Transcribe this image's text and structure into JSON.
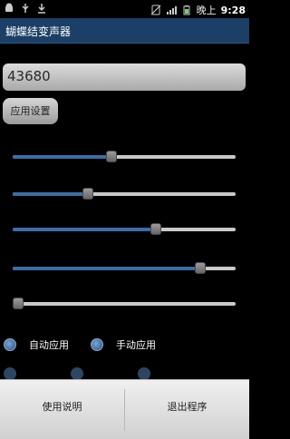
{
  "status_bar": {
    "period": "晚上",
    "time": "9:28"
  },
  "title": "蝴蝶结变声器",
  "number_field": {
    "value": "43680"
  },
  "settings_button": {
    "label": "应用设置"
  },
  "sliders": [
    {
      "level": 0.44
    },
    {
      "level": 0.33
    },
    {
      "level": 0.65
    },
    {
      "level": 0.86
    },
    {
      "level": 0.0
    }
  ],
  "radio_auto": {
    "label": "自动应用",
    "selected": false
  },
  "radio_manual": {
    "label": "手动应用",
    "selected": false
  },
  "menu": {
    "help_label": "使用说明",
    "exit_label": "退出程序"
  },
  "colors": {
    "title_bar": "#1b3f66",
    "accent": "#3b6da6"
  }
}
